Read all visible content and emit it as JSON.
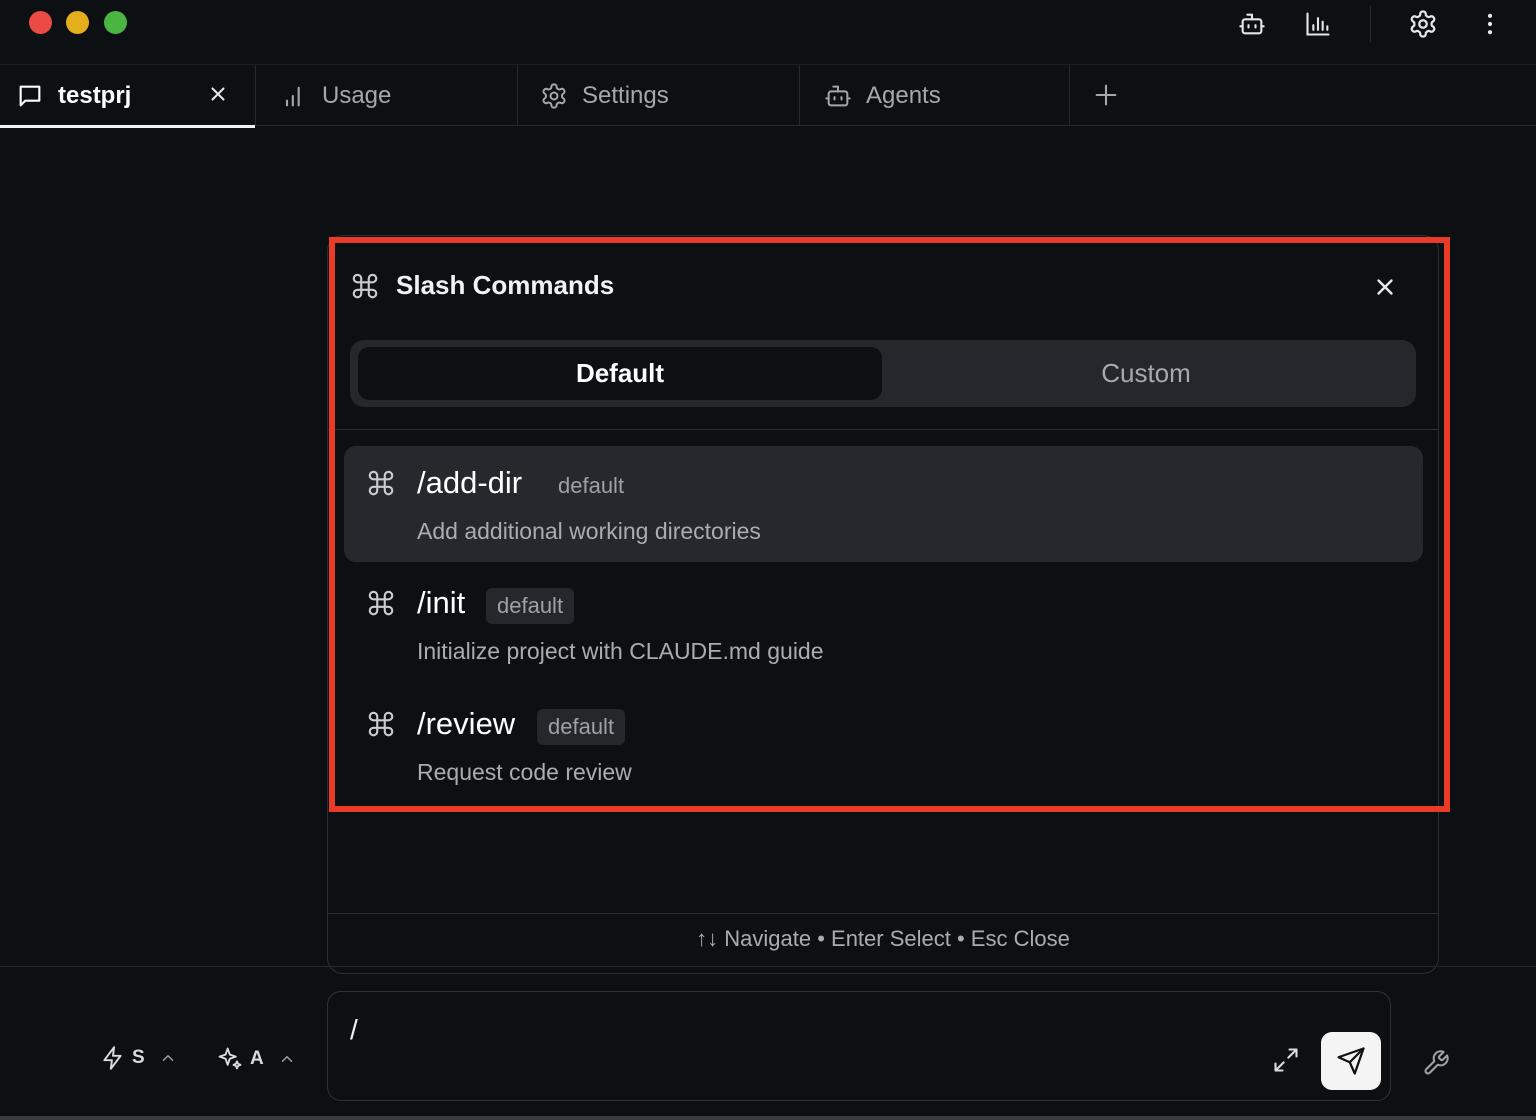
{
  "window": {
    "controls": [
      "close",
      "minimize",
      "maximize"
    ],
    "toolbar_icons": [
      "agent-icon",
      "usage-chart-icon",
      "settings-gear-icon",
      "more-vertical-icon"
    ]
  },
  "tabs": [
    {
      "label": "testprj",
      "icon": "chat-bubble-icon",
      "active": true,
      "closable": true
    },
    {
      "label": "Usage",
      "icon": "bar-chart-icon",
      "active": false
    },
    {
      "label": "Settings",
      "icon": "gear-icon",
      "active": false
    },
    {
      "label": "Agents",
      "icon": "robot-icon",
      "active": false
    }
  ],
  "slash_popup": {
    "title": "Slash Commands",
    "segments": {
      "default": "Default",
      "custom": "Custom",
      "selected": "Default"
    },
    "commands": [
      {
        "name": "/add-dir",
        "badge": "default",
        "description": "Add additional working directories",
        "selected": true
      },
      {
        "name": "/init",
        "badge": "default",
        "description": "Initialize project with CLAUDE.md guide",
        "selected": false
      },
      {
        "name": "/review",
        "badge": "default",
        "description": "Request code review",
        "selected": false
      }
    ],
    "footer_hint": "↑↓ Navigate • Enter Select • Esc Close"
  },
  "composer": {
    "value": "/",
    "model_selector_label": "S",
    "thinking_selector_label": "A"
  },
  "colors": {
    "background": "#0d1013",
    "highlight_frame": "#ea3a28",
    "selected_row": "#25292d",
    "send_button": "#f4f4f4"
  }
}
